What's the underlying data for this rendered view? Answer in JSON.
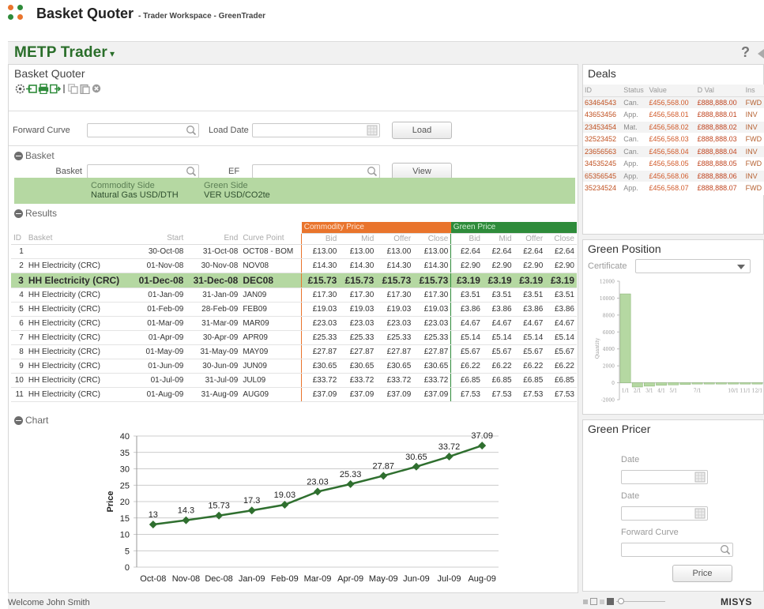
{
  "app": {
    "title": "Basket Quoter",
    "subtitle": "- Trader Workspace - GreenTrader"
  },
  "workspace": {
    "title": "METP Trader",
    "help": "?"
  },
  "basket_quoter": {
    "title": "Basket Quoter",
    "toolbar_icons": [
      "settings-icon",
      "add-icon",
      "print-icon",
      "export-icon",
      "copy-icon",
      "paste-icon",
      "close-circle-icon"
    ],
    "forward_curve_label": "Forward Curve",
    "forward_curve_value": "",
    "load_date_label": "Load Date",
    "load_date_value": "",
    "load_button": "Load",
    "basket_section": "Basket",
    "basket_label": "Basket",
    "basket_value": "",
    "ef_label": "EF",
    "ef_value": "",
    "view_button": "View",
    "commodity_side_label": "Commodity Side",
    "commodity_side_value": "Natural Gas USD/DTH",
    "green_side_label": "Green Side",
    "green_side_value": "VER USD/CO2te",
    "results_section": "Results",
    "chart_section": "Chart"
  },
  "results": {
    "group_commodity": "Commodity Price",
    "group_green": "Green Price",
    "columns": [
      "ID",
      "Basket",
      "Start",
      "End",
      "Curve Point",
      "Bid",
      "Mid",
      "Offer",
      "Close",
      "Bid",
      "Mid",
      "Offer",
      "Close"
    ],
    "rows": [
      [
        "1",
        "",
        "30-Oct-08",
        "31-Oct-08",
        "OCT08 - BOM",
        "£13.00",
        "£13.00",
        "£13.00",
        "£13.00",
        "£2.64",
        "£2.64",
        "£2.64",
        "£2.64"
      ],
      [
        "2",
        "HH Electricity (CRC)",
        "01-Nov-08",
        "30-Nov-08",
        "NOV08",
        "£14.30",
        "£14.30",
        "£14.30",
        "£14.30",
        "£2.90",
        "£2.90",
        "£2.90",
        "£2.90"
      ],
      [
        "3",
        "HH Electricity (CRC)",
        "01-Dec-08",
        "31-Dec-08",
        "DEC08",
        "£15.73",
        "£15.73",
        "£15.73",
        "£15.73",
        "£3.19",
        "£3.19",
        "£3.19",
        "£3.19"
      ],
      [
        "4",
        "HH Electricity (CRC)",
        "01-Jan-09",
        "31-Jan-09",
        "JAN09",
        "£17.30",
        "£17.30",
        "£17.30",
        "£17.30",
        "£3.51",
        "£3.51",
        "£3.51",
        "£3.51"
      ],
      [
        "5",
        "HH Electricity (CRC)",
        "01-Feb-09",
        "28-Feb-09",
        "FEB09",
        "£19.03",
        "£19.03",
        "£19.03",
        "£19.03",
        "£3.86",
        "£3.86",
        "£3.86",
        "£3.86"
      ],
      [
        "6",
        "HH Electricity (CRC)",
        "01-Mar-09",
        "31-Mar-09",
        "MAR09",
        "£23.03",
        "£23.03",
        "£23.03",
        "£23.03",
        "£4.67",
        "£4.67",
        "£4.67",
        "£4.67"
      ],
      [
        "7",
        "HH Electricity (CRC)",
        "01-Apr-09",
        "30-Apr-09",
        "APR09",
        "£25.33",
        "£25.33",
        "£25.33",
        "£25.33",
        "£5.14",
        "£5.14",
        "£5.14",
        "£5.14"
      ],
      [
        "8",
        "HH Electricity (CRC)",
        "01-May-09",
        "31-May-09",
        "MAY09",
        "£27.87",
        "£27.87",
        "£27.87",
        "£27.87",
        "£5.67",
        "£5.67",
        "£5.67",
        "£5.67"
      ],
      [
        "9",
        "HH Electricity (CRC)",
        "01-Jun-09",
        "30-Jun-09",
        "JUN09",
        "£30.65",
        "£30.65",
        "£30.65",
        "£30.65",
        "£6.22",
        "£6.22",
        "£6.22",
        "£6.22"
      ],
      [
        "10",
        "HH Electricity (CRC)",
        "01-Jul-09",
        "31-Jul-09",
        "JUL09",
        "£33.72",
        "£33.72",
        "£33.72",
        "£33.72",
        "£6.85",
        "£6.85",
        "£6.85",
        "£6.85"
      ],
      [
        "11",
        "HH Electricity (CRC)",
        "01-Aug-09",
        "31-Aug-09",
        "AUG09",
        "£37.09",
        "£37.09",
        "£37.09",
        "£37.09",
        "£7.53",
        "£7.53",
        "£7.53",
        "£7.53"
      ]
    ],
    "selected_row": 2
  },
  "chart_data": [
    {
      "type": "line",
      "categories": [
        "Oct-08",
        "Nov-08",
        "Dec-08",
        "Jan-09",
        "Feb-09",
        "Mar-09",
        "Apr-09",
        "May-09",
        "Jun-09",
        "Jul-09",
        "Aug-09"
      ],
      "values": [
        13,
        14.3,
        15.73,
        17.3,
        19.03,
        23.03,
        25.33,
        27.87,
        30.65,
        33.72,
        37.09
      ],
      "data_labels": [
        "13",
        "14.3",
        "15.73",
        "17.3",
        "19.03",
        "23.03",
        "25.33",
        "27.87",
        "30.65",
        "33.72",
        "37.09"
      ],
      "ylabel": "Price",
      "ylim": [
        0,
        40
      ],
      "yticks": [
        "0",
        "5",
        "10",
        "15",
        "20",
        "25",
        "30",
        "35",
        "40"
      ],
      "grid": true,
      "color": "#2f6f2f"
    },
    {
      "type": "bar",
      "categories": [
        "1/1",
        "2/1",
        "3/1",
        "4/1",
        "5/1",
        "",
        "7/1",
        "",
        "",
        "10/1",
        "11/1",
        "12/1"
      ],
      "values": [
        10500,
        -500,
        -400,
        -300,
        -250,
        -200,
        -150,
        -150,
        -150,
        -150,
        -150,
        -150
      ],
      "ylabel": "Quantity",
      "ylim": [
        -2000,
        12000
      ],
      "yticks": [
        "12000",
        "10000",
        "8000",
        "6000",
        "4000",
        "2000",
        "0",
        "-2000"
      ],
      "color": "#b5d8a2"
    }
  ],
  "deals": {
    "title": "Deals",
    "columns": [
      "ID",
      "Status",
      "Value",
      "D Val",
      "Ins"
    ],
    "rows": [
      [
        "63464543",
        "Can.",
        "£456,568.00",
        "£888,888.00",
        "FWD"
      ],
      [
        "43653456",
        "App.",
        "£456,568.01",
        "£888,888.01",
        "INV"
      ],
      [
        "23453454",
        "Mat.",
        "£456,568.02",
        "£888,888.02",
        "INV"
      ],
      [
        "32523452",
        "Can.",
        "£456,568.03",
        "£888,888.03",
        "FWD"
      ],
      [
        "23656563",
        "Can.",
        "£456,568.04",
        "£888,888.04",
        "INV"
      ],
      [
        "34535245",
        "App.",
        "£456,568.05",
        "£888,888.05",
        "FWD"
      ],
      [
        "65356545",
        "App.",
        "£456,568.06",
        "£888,888.06",
        "INV"
      ],
      [
        "35234524",
        "App.",
        "£456,568.07",
        "£888,888.07",
        "FWD"
      ]
    ]
  },
  "green_position": {
    "title": "Green Position",
    "certificate_label": "Certificate",
    "certificate_value": ""
  },
  "green_pricer": {
    "title": "Green Pricer",
    "date1_label": "Date",
    "date2_label": "Date",
    "forward_curve_label": "Forward Curve",
    "price_button": "Price"
  },
  "status": {
    "welcome": "Welcome John Smith",
    "brand": "MISYS"
  },
  "colors": {
    "accent_green": "#2a6e2a",
    "band_green": "#b5d8a2",
    "orange": "#e9742c",
    "dark_green": "#2e8b3a"
  }
}
